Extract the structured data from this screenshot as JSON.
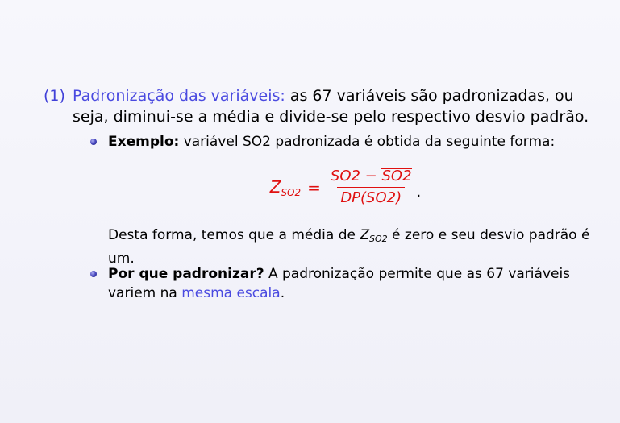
{
  "item": {
    "number": "(1)",
    "title": "Padronização das variáveis:",
    "text": " as 67 variáveis são padronizadas, ou seja, diminui-se a média e divide-se pelo respectivo desvio padrão."
  },
  "bullet1": {
    "label": "Exemplo:",
    "text": " variável SO2 padronizada é obtida da seguinte forma:"
  },
  "formula": {
    "lhs_var": "Z",
    "lhs_sub": "SO2",
    "equals": "=",
    "num_left": "SO2 − ",
    "num_bar": "SO2",
    "den_dp": "DP",
    "den_arg": "(SO2)",
    "period": "."
  },
  "paragraph": {
    "before": "Desta forma, temos que a média de ",
    "z_var": "Z",
    "z_sub": "SO2",
    "after": " é zero e seu desvio padrão é um."
  },
  "bullet2": {
    "label": "Por que padronizar?",
    "text_before": " A padronização permite que as 67 variáveis variem na ",
    "highlight": "mesma escala",
    "text_after": "."
  },
  "colors": {
    "accent_blue": "#4a4ae0",
    "formula_red": "#e01010"
  }
}
